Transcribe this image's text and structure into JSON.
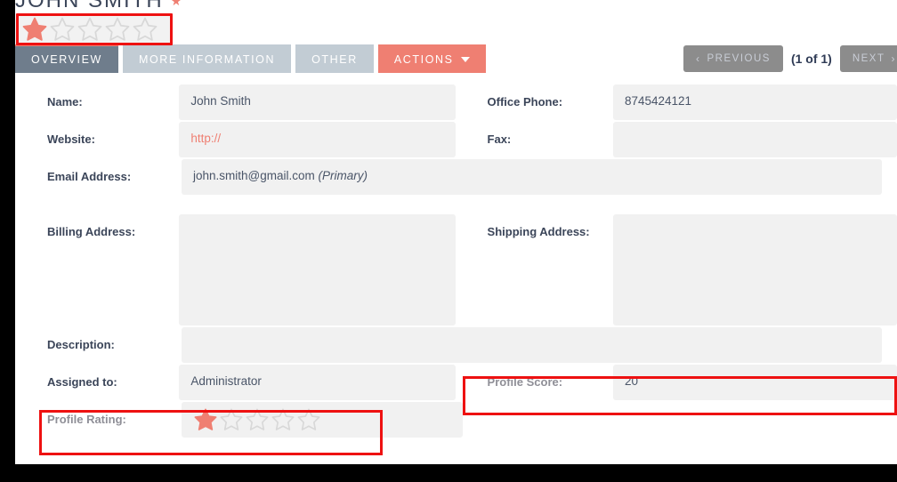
{
  "record": {
    "title": "JOHN SMITH",
    "title_star_icon": "star-icon",
    "top_rating": {
      "label": "record-rating",
      "value": 1,
      "max": 5
    }
  },
  "tabs": [
    {
      "id": "overview",
      "label": "OVERVIEW",
      "state": "active"
    },
    {
      "id": "more-information",
      "label": "MORE INFORMATION",
      "state": "inactive"
    },
    {
      "id": "other",
      "label": "OTHER",
      "state": "inactive"
    },
    {
      "id": "actions",
      "label": "ACTIONS",
      "state": "action",
      "caret": "chevron-down-icon"
    }
  ],
  "pagination": {
    "previous_label": "PREVIOUS",
    "previous_chevron": "‹",
    "count_label": "(1 of 1)",
    "next_label": "NEXT",
    "next_chevron": "›"
  },
  "fields": {
    "name_label": "Name:",
    "name_value": "John Smith",
    "office_phone_label": "Office Phone:",
    "office_phone_value": "8745424121",
    "website_label": "Website:",
    "website_value": "http://",
    "fax_label": "Fax:",
    "fax_value": "",
    "email_label": "Email Address:",
    "email_value": "john.smith@gmail.com",
    "email_primary_note": "(Primary)",
    "billing_address_label": "Billing Address:",
    "billing_address_value": "",
    "shipping_address_label": "Shipping Address:",
    "shipping_address_value": "",
    "description_label": "Description:",
    "description_value": "",
    "assigned_to_label": "Assigned to:",
    "assigned_to_value": "Administrator",
    "profile_score_label": "Profile Score:",
    "profile_score_value": "20",
    "profile_rating_label": "Profile Rating:",
    "profile_rating_value": 1,
    "profile_rating_max": 5
  },
  "colors": {
    "accent": "#ef7f72",
    "active_tab": "#6f7d8c",
    "inactive_tab": "#c2ccd4",
    "label": "#3b4559",
    "field_bg": "#f1f1f1",
    "highlight": "#ee1111",
    "star_filled": "#ef7f72",
    "star_empty": "#d8d8d8"
  }
}
